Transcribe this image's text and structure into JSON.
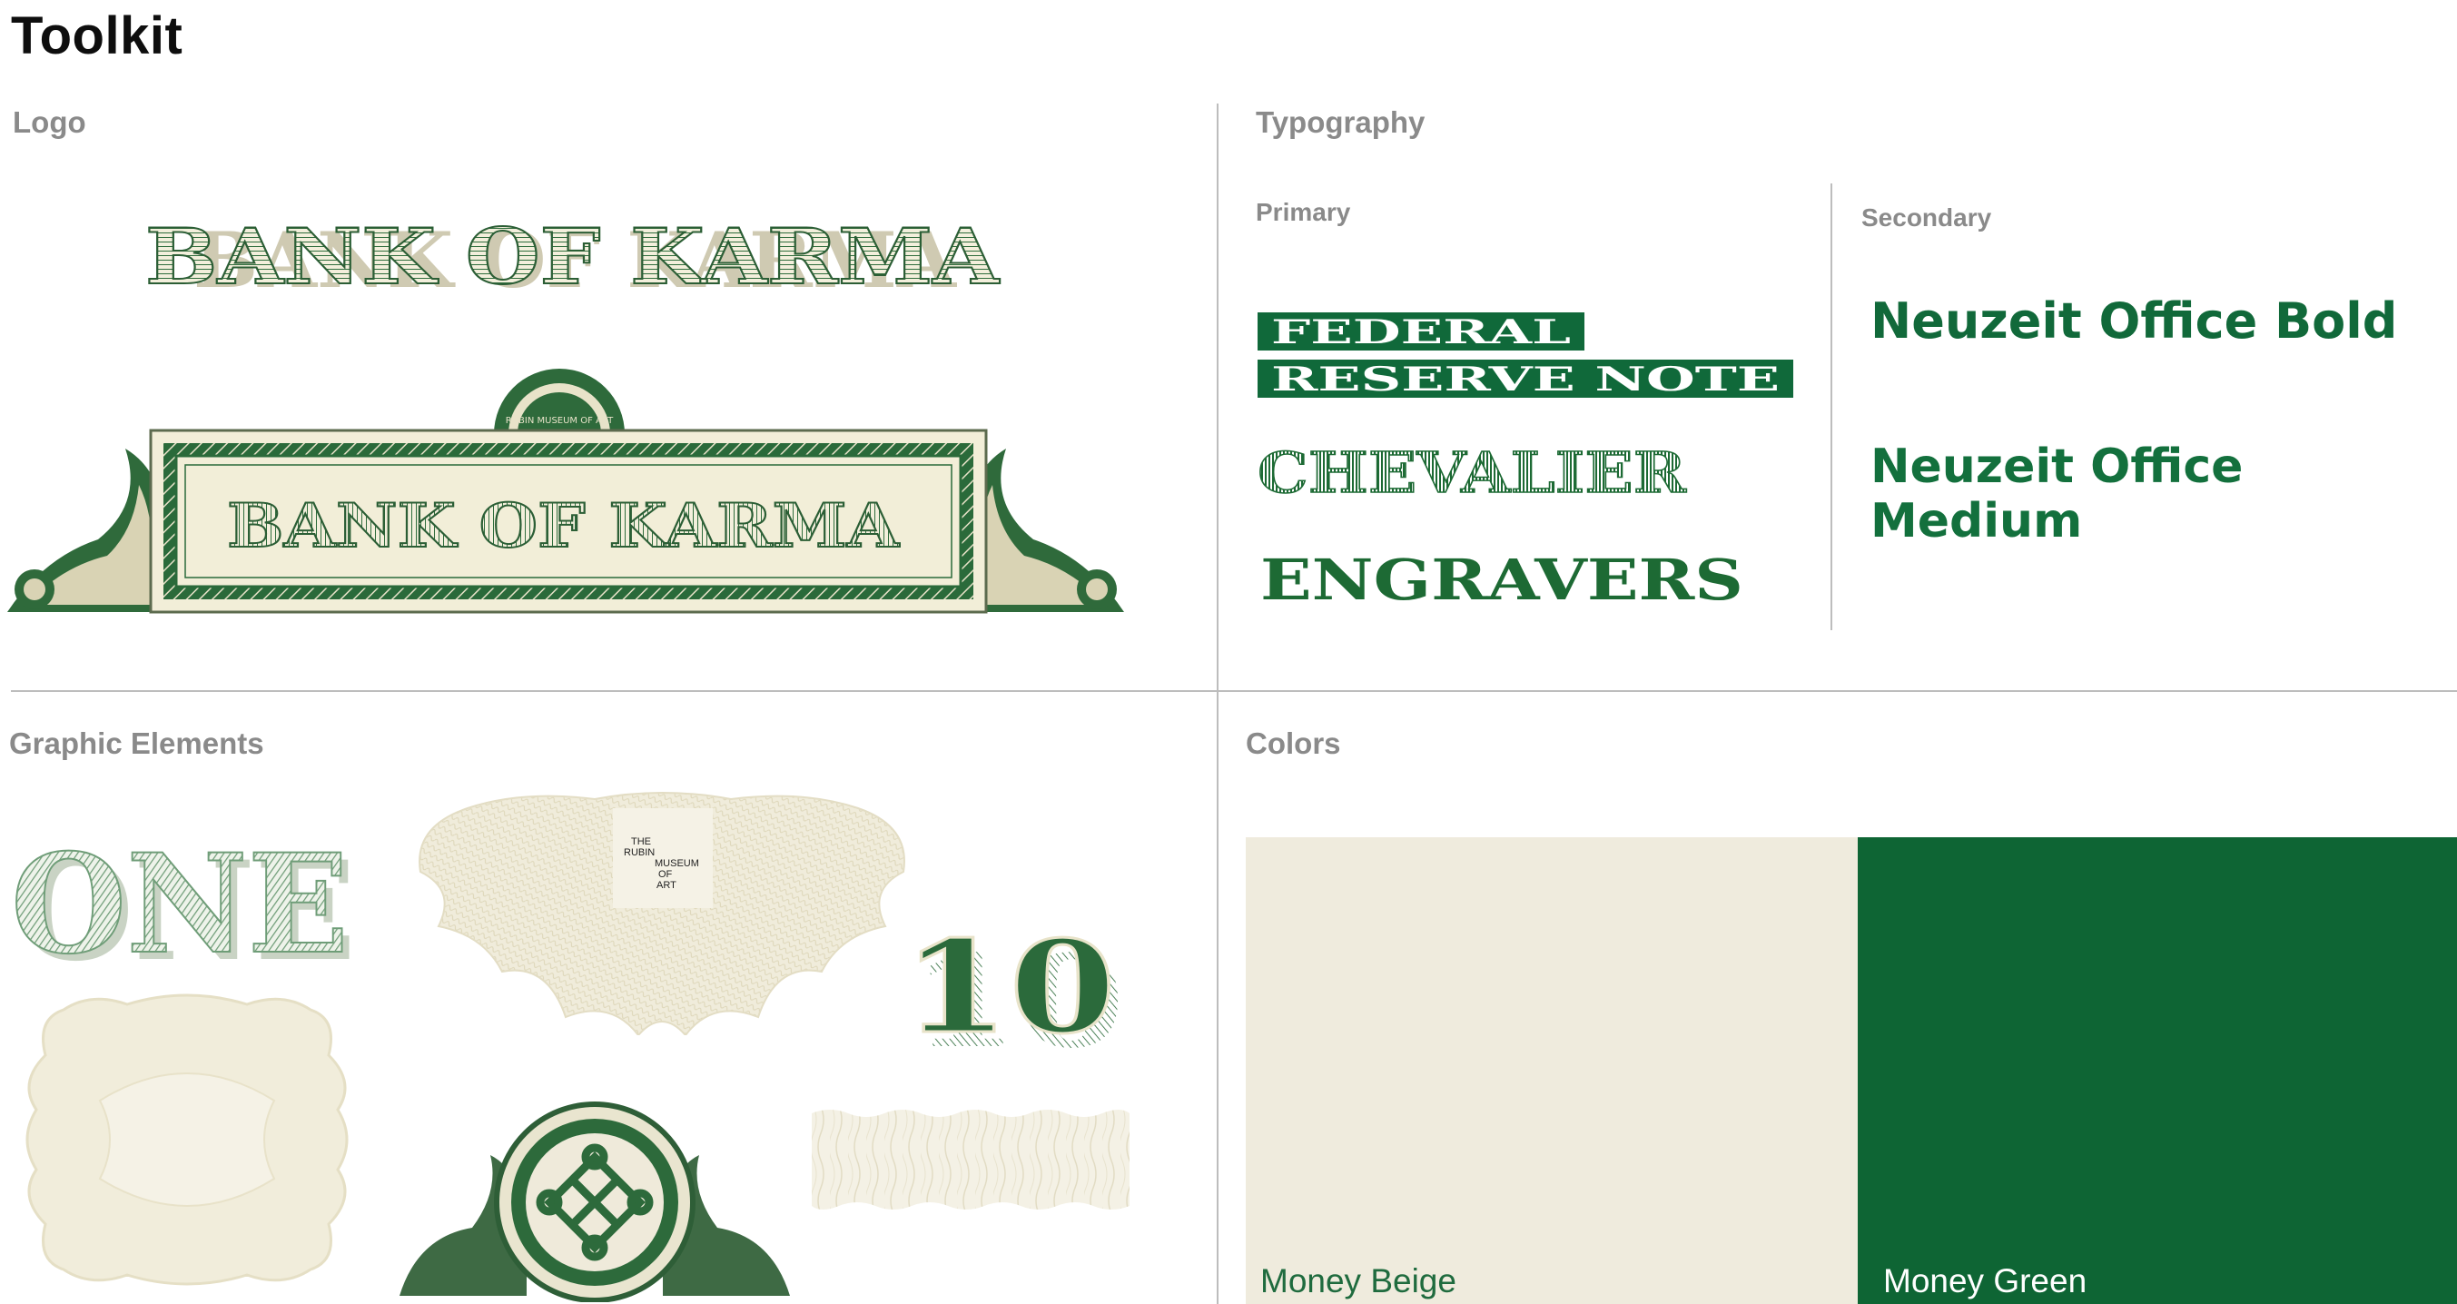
{
  "page": {
    "title": "Toolkit"
  },
  "logo": {
    "title": "Logo",
    "wordmark_text": "BANK OF KARMA",
    "banner_text": "BANK OF KARMA",
    "seal_text": "RUBIN MUSEUM OF ART"
  },
  "typography": {
    "title": "Typography",
    "primary": {
      "label": "Primary",
      "fonts": [
        "FEDERAL",
        "RESERVE NOTE",
        "CHEVALIER",
        "ENGRAVERS"
      ]
    },
    "secondary": {
      "label": "Secondary",
      "fonts": [
        "Neuzeit Office Bold",
        "Neuzeit Office Medium"
      ]
    }
  },
  "graphic_elements": {
    "title": "Graphic Elements",
    "one_text": "ONE",
    "ten_text": "10",
    "museum_text": [
      "THE",
      "RUBIN",
      "MUSEUM",
      "OF",
      "ART"
    ]
  },
  "colors": {
    "title": "Colors",
    "swatches": [
      {
        "name": "Money Beige",
        "hex": "#efebdd"
      },
      {
        "name": "Money Green",
        "hex": "#0e6534"
      }
    ]
  },
  "palette": {
    "accent_green": "#1d6a34",
    "dark_green": "#0e6534",
    "beige": "#efebdd",
    "rule": "#bdbdbd",
    "label_gray": "#8a8a8a"
  }
}
